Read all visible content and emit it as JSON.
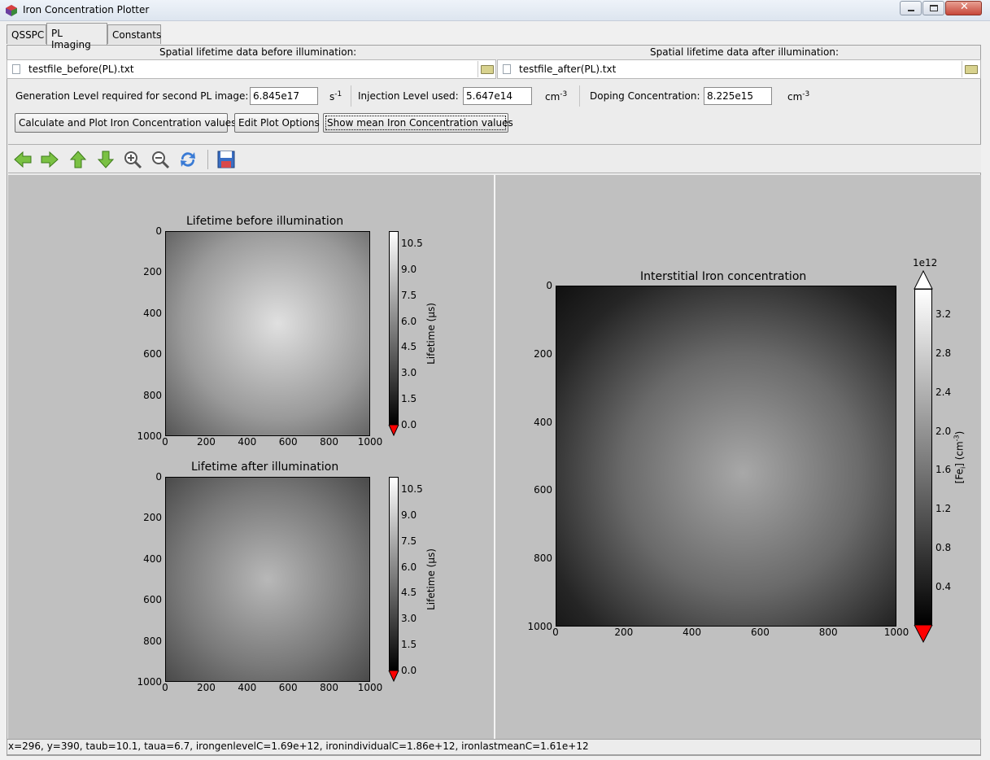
{
  "window": {
    "title": "Iron Concentration Plotter"
  },
  "tabs": [
    {
      "label": "QSSPC"
    },
    {
      "label": "PL Imaging"
    },
    {
      "label": "Constants"
    }
  ],
  "files": {
    "before_header": "Spatial lifetime data before illumination:",
    "after_header": "Spatial lifetime data after illumination:",
    "before_file": "testfile_before(PL).txt",
    "after_file": "testfile_after(PL).txt"
  },
  "params": {
    "generation_label": "Generation Level required for second PL image:",
    "generation_value": "6.845e17",
    "generation_unit": "s",
    "generation_unit_exp": "-1",
    "injection_label": "Injection Level used:",
    "injection_value": "5.647e14",
    "injection_unit": "cm",
    "injection_unit_exp": "-3",
    "doping_label": "Doping Concentration:",
    "doping_value": "8.225e15",
    "doping_unit": "cm",
    "doping_unit_exp": "-3"
  },
  "buttons": {
    "calculate": "Calculate and Plot Iron Concentration values",
    "edit": "Edit Plot Options",
    "mean": "Show mean Iron Concentration values"
  },
  "toolbar_icons": [
    "back-icon",
    "forward-icon",
    "pan-up-icon",
    "pan-down-icon",
    "zoom-in-icon",
    "zoom-out-icon",
    "refresh-icon",
    "save-icon"
  ],
  "plots": {
    "before": {
      "title": "Lifetime before illumination",
      "xticks": [
        "0",
        "200",
        "400",
        "600",
        "800",
        "1000"
      ],
      "yticks": [
        "0",
        "200",
        "400",
        "600",
        "800",
        "1000"
      ],
      "cbar_ticks": [
        "10.5",
        "9.0",
        "7.5",
        "6.0",
        "4.5",
        "3.0",
        "1.5",
        "0.0"
      ],
      "cbar_label": "Lifetime (μs)"
    },
    "after": {
      "title": "Lifetime after illumination",
      "xticks": [
        "0",
        "200",
        "400",
        "600",
        "800",
        "1000"
      ],
      "yticks": [
        "0",
        "200",
        "400",
        "600",
        "800",
        "1000"
      ],
      "cbar_ticks": [
        "10.5",
        "9.0",
        "7.5",
        "6.0",
        "4.5",
        "3.0",
        "1.5",
        "0.0"
      ],
      "cbar_label": "Lifetime (μs)"
    },
    "iron": {
      "title": "Interstitial Iron concentration",
      "xticks": [
        "0",
        "200",
        "400",
        "600",
        "800",
        "1000"
      ],
      "yticks": [
        "0",
        "200",
        "400",
        "600",
        "800",
        "1000"
      ],
      "cbar_ticks": [
        "3.2",
        "2.8",
        "2.4",
        "2.0",
        "1.6",
        "1.2",
        "0.8",
        "0.4"
      ],
      "cbar_multiplier": "1e12",
      "cbar_label": "[Fe",
      "cbar_label_sub": "i",
      "cbar_label_end": "]  (cm",
      "cbar_label_exp": "-3",
      "cbar_label_close": ")"
    }
  },
  "status": "x=296, y=390, taub=10.1, taua=6.7, irongenlevelC=1.69e+12, ironindividualC=1.86e+12, ironlastmeanC=1.61e+12"
}
